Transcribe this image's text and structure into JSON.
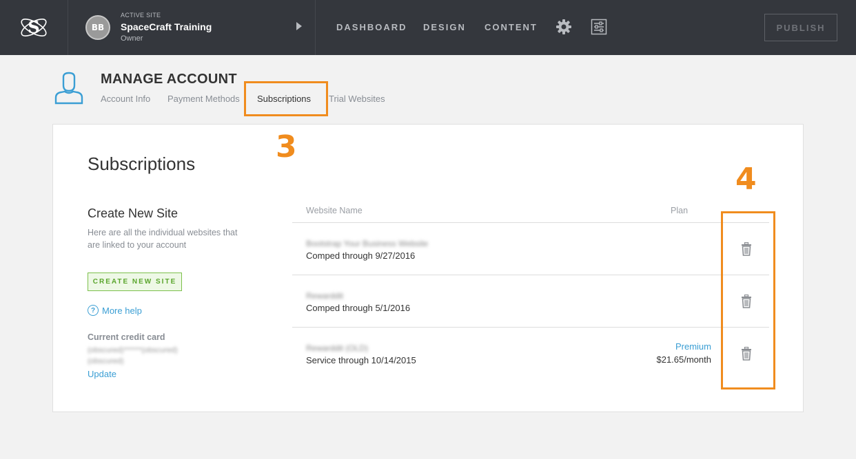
{
  "topbar": {
    "logo_letter": "S",
    "active_site_label": "ACTIVE SITE",
    "avatar_initials": "BB",
    "site_name": "SpaceCraft Training",
    "site_role": "Owner",
    "nav": [
      "DASHBOARD",
      "DESIGN",
      "CONTENT"
    ],
    "publish_label": "PUBLISH"
  },
  "account": {
    "title": "MANAGE ACCOUNT",
    "tabs": [
      "Account Info",
      "Payment Methods",
      "Subscriptions",
      "Trial Websites"
    ],
    "active_tab": "Subscriptions"
  },
  "annotations": {
    "callout_tab_number": "3",
    "callout_trash_number": "4",
    "color": "#f08c1e"
  },
  "panel": {
    "title": "Subscriptions",
    "create_title": "Create New Site",
    "create_desc": "Here are all the individual websites that are linked to your account",
    "create_button": "CREATE NEW SITE",
    "help_icon": "?",
    "help_link": "More help",
    "credit_card_label": "Current credit card",
    "credit_card_value": "(obscured)******(obscured)",
    "credit_card_value2": "(obscured)",
    "update_link": "Update",
    "table": {
      "headers": {
        "website_name": "Website Name",
        "plan": "Plan"
      },
      "rows": [
        {
          "name": "Bootstrap Your Business Website",
          "status": "Comped through 9/27/2016",
          "plan": "",
          "price": ""
        },
        {
          "name": "Rewarddit",
          "status": "Comped through 5/1/2016",
          "plan": "",
          "price": ""
        },
        {
          "name": "Rewarddit (OLD)",
          "status": "Service through 10/14/2015",
          "plan": "Premium",
          "price": "$21.65/month"
        }
      ]
    }
  },
  "colors": {
    "topbar_bg": "#34373d",
    "accent_blue": "#3a9ed4",
    "accent_green": "#7cc04b"
  }
}
